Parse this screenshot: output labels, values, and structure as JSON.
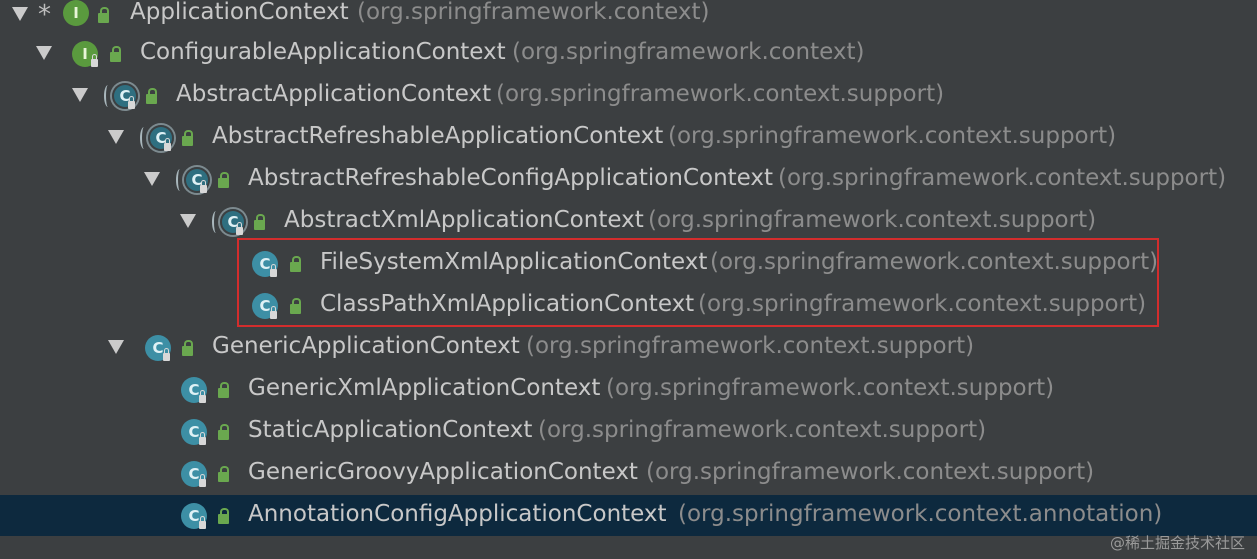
{
  "tree": {
    "root": {
      "marker": "*",
      "kind": "interface",
      "kind_letter": "I",
      "name": "ApplicationContext",
      "package": "(org.springframework.context)"
    },
    "nodes": [
      {
        "kind": "interface",
        "kind_letter": "I",
        "name": "ConfigurableApplicationContext",
        "package": "(org.springframework.context)",
        "expanded": true
      },
      {
        "kind": "abstract",
        "kind_letter": "C",
        "name": "AbstractApplicationContext",
        "package": "(org.springframework.context.support)",
        "expanded": true
      },
      {
        "kind": "abstract",
        "kind_letter": "C",
        "name": "AbstractRefreshableApplicationContext",
        "package": "(org.springframework.context.support)",
        "expanded": true
      },
      {
        "kind": "abstract",
        "kind_letter": "C",
        "name": "AbstractRefreshableConfigApplicationContext",
        "package": "(org.springframework.context.support)",
        "expanded": true
      },
      {
        "kind": "abstract",
        "kind_letter": "C",
        "name": "AbstractXmlApplicationContext",
        "package": "(org.springframework.context.support)",
        "expanded": true
      },
      {
        "kind": "class",
        "kind_letter": "C",
        "name": "FileSystemXmlApplicationContext",
        "package": "(org.springframework.context.support)",
        "highlighted": true
      },
      {
        "kind": "class",
        "kind_letter": "C",
        "name": "ClassPathXmlApplicationContext",
        "package": "(org.springframework.context.support)",
        "highlighted": true
      },
      {
        "kind": "class",
        "kind_letter": "C",
        "name": "GenericApplicationContext",
        "package": "(org.springframework.context.support)",
        "expanded": true
      },
      {
        "kind": "class",
        "kind_letter": "C",
        "name": "GenericXmlApplicationContext",
        "package": "(org.springframework.context.support)"
      },
      {
        "kind": "class",
        "kind_letter": "C",
        "name": "StaticApplicationContext",
        "package": "(org.springframework.context.support)"
      },
      {
        "kind": "class",
        "kind_letter": "C",
        "name": "GenericGroovyApplicationContext",
        "package": "(org.springframework.context.support)"
      },
      {
        "kind": "class",
        "kind_letter": "C",
        "name": "AnnotationConfigApplicationContext",
        "package": "(org.springframework.context.annotation)",
        "selected": true
      }
    ]
  },
  "icons": {
    "expand": "chevron-down-icon",
    "interface": "interface-icon",
    "class": "class-icon",
    "abstract_class": "abstract-class-icon",
    "visibility": "public-lock-icon"
  },
  "colors": {
    "background": "#3c3f41",
    "selected_row": "#0d293e",
    "highlight_border": "#d32d2d",
    "name_text": "#c8c8c8",
    "package_text": "#8c8c8c",
    "interface_icon": "#5a9a3e",
    "class_icon": "#3d8fa5",
    "lock_icon": "#6aa84f"
  },
  "watermark": "@稀土掘金技术社区"
}
